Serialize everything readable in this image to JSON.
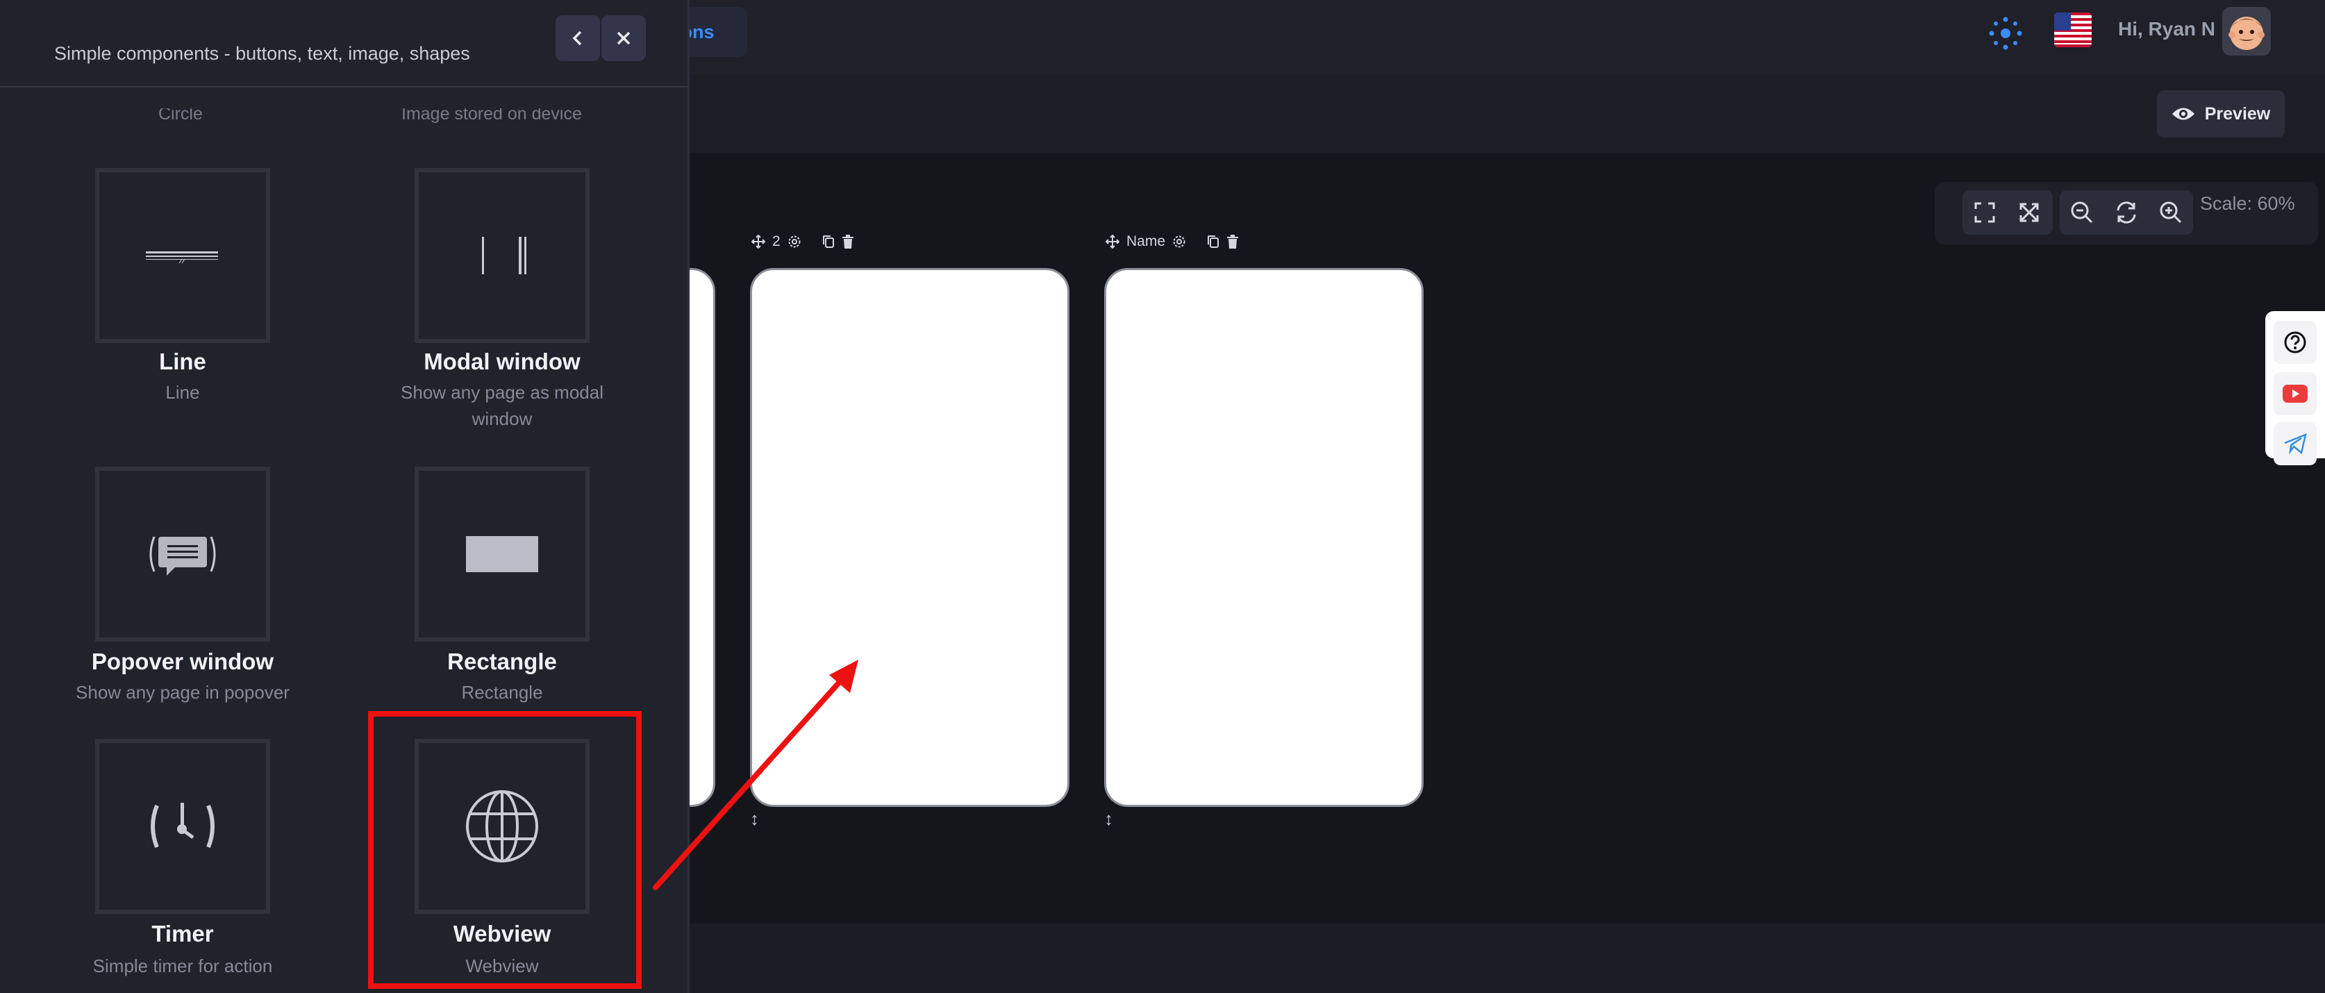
{
  "header": {
    "tab_partial": "tions",
    "greeting": "Hi, Ryan N"
  },
  "toolbar": {
    "preview_label": "Preview"
  },
  "zoom": {
    "scale_label": "Scale: 60%"
  },
  "panel": {
    "subtitle": "Simple components - buttons, text, image, shapes",
    "cut_left": "Circle",
    "cut_right": "Image stored on device",
    "components": [
      {
        "title": "Line",
        "desc": "Line",
        "icon": "line-icon"
      },
      {
        "title": "Modal window",
        "desc": "Show any page as modal window",
        "icon": "modal-window-icon"
      },
      {
        "title": "Popover window",
        "desc": "Show any page in popover",
        "icon": "popover-icon"
      },
      {
        "title": "Rectangle",
        "desc": "Rectangle",
        "icon": "rectangle-icon"
      },
      {
        "title": "Timer",
        "desc": "Simple timer for action",
        "icon": "timer-icon"
      },
      {
        "title": "Webview",
        "desc": "Webview",
        "icon": "globe-icon"
      }
    ]
  },
  "pages": [
    {
      "label": "2"
    },
    {
      "label": "Name"
    }
  ],
  "annotation": {
    "highlight_color": "#ee1111"
  }
}
